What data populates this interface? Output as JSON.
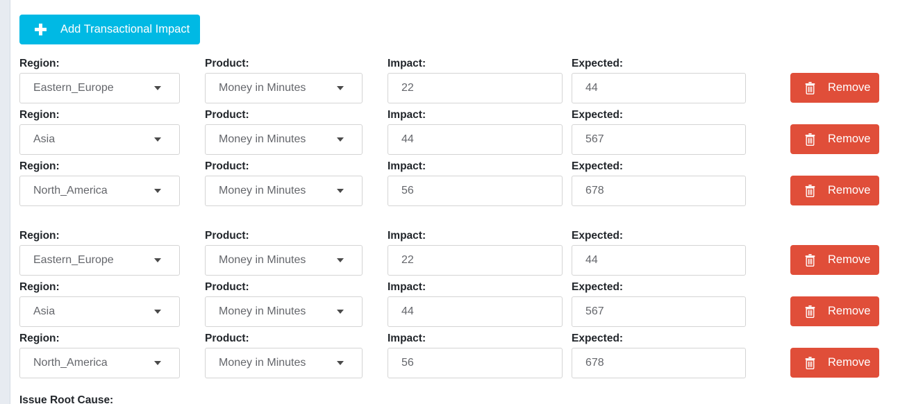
{
  "toolbar": {
    "add_button_label": "Add Transactional Impact",
    "add_button_icon": "plus-icon",
    "add_button_color": "#00b9e4"
  },
  "labels": {
    "region": "Region:",
    "product": "Product:",
    "impact": "Impact:",
    "expected": "Expected:"
  },
  "remove": {
    "label": "Remove",
    "icon": "trash-icon",
    "color": "#e04e39"
  },
  "rows": [
    {
      "region": "Eastern_Europe",
      "product": "Money in Minutes",
      "impact": "22",
      "expected": "44"
    },
    {
      "region": "Asia",
      "product": "Money in Minutes",
      "impact": "44",
      "expected": "567"
    },
    {
      "region": "North_America",
      "product": "Money in Minutes",
      "impact": "56",
      "expected": "678"
    },
    {
      "region": "Eastern_Europe",
      "product": "Money in Minutes",
      "impact": "22",
      "expected": "44"
    },
    {
      "region": "Asia",
      "product": "Money in Minutes",
      "impact": "44",
      "expected": "567"
    },
    {
      "region": "North_America",
      "product": "Money in Minutes",
      "impact": "56",
      "expected": "678"
    }
  ],
  "footer": {
    "issue_root_cause_label": "Issue Root Cause:"
  }
}
